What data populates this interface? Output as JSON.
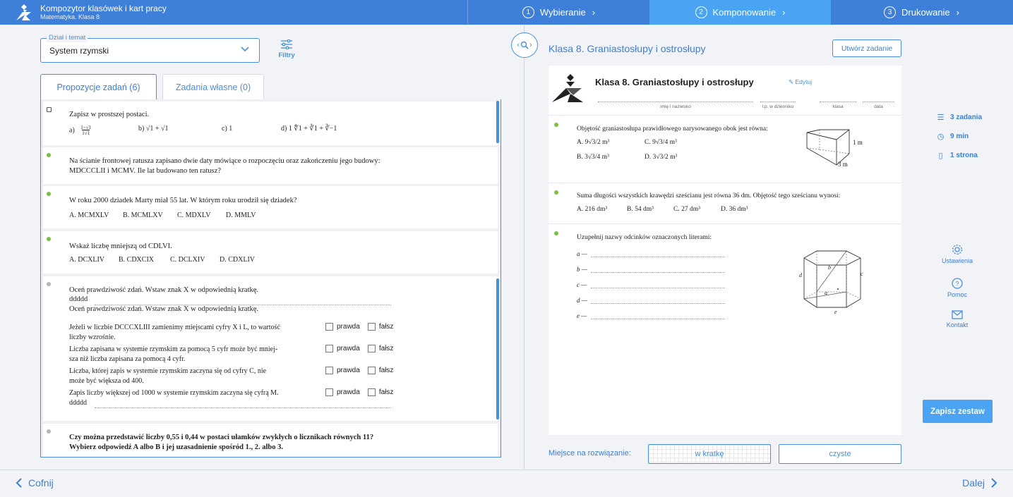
{
  "header": {
    "app_title": "Kompozytor klasówek i kart pracy",
    "app_subtitle": "Matematyka. Klasa 8",
    "steps": [
      {
        "num": "1",
        "label": "Wybieranie"
      },
      {
        "num": "2",
        "label": "Komponowanie"
      },
      {
        "num": "3",
        "label": "Drukowanie"
      }
    ]
  },
  "left": {
    "topic_label": "Dział i temat",
    "topic_value": "System rzymski",
    "filters_label": "Filtry",
    "tabs": [
      "Propozycje zadań (6)",
      "Zadania własne (0)"
    ],
    "tasks": [
      {
        "text": "Zapisz w prostszej postaci.",
        "options": [
          "a)",
          "b) √1 + √1",
          "c) 1",
          "d) 1 ∜1 + ∛1 + ∛−1"
        ]
      },
      {
        "text1": "Na ścianie frontowej ratusza zapisano dwie daty mówiące o rozpoczęciu oraz zakończeniu jego budowy:",
        "text2": "MDCCCLII i MCMV. Ile lat budowano ten ratusz?"
      },
      {
        "text": "W roku 2000 dziadek Marty miał 55 lat. W którym roku urodził się dziadek?",
        "options": [
          "A. MCMXLV",
          "B. MCMLXV",
          "C. MDXLV",
          "D. MMLV"
        ]
      },
      {
        "text": "Wskaż liczbę mniejszą od CDLVI.",
        "options": [
          "A. DCXLIV",
          "B. CDXCIX",
          "C. DCLXIV",
          "D. CDXLIV"
        ]
      },
      {
        "line1": "Oceń prawdziwość zdań. Wstaw znak X w odpowiednią kratkę.",
        "line2": "ddddd",
        "line3": "Oceń prawdziwość zdań. Wstaw znak X w odpowiednią kratkę.",
        "statements": [
          {
            "a": "Jeżeli w liczbie DCCCXLIII zamienimy miejscami cyfry X i L, to wartość",
            "b": "liczby wzrośnie."
          },
          {
            "a": "Liczba zapisana w systemie rzymskim za pomocą 5 cyfr może być mniej-",
            "b": "sza niż liczba zapisana za pomocą 4 cyfr."
          },
          {
            "a": "Liczba, której zapis w systemie rzymskim zaczyna się od cyfry C, nie",
            "b": "może być większa od 400."
          },
          {
            "a": "Zapis liczby większej od 1000 w systemie rzymskim zaczyna się cyfrą M.",
            "b": "ddddd"
          }
        ],
        "true_label": "prawda",
        "false_label": "fałsz"
      },
      {
        "line1": "Czy można przedstawić liczby 0,55 i 0,44 w postaci ułamków zwykłych o licznikach równych 11?",
        "line2": "Wybierz odpowiedź A albo B i jej uzasadnienie spośród 1., 2. albo 3."
      }
    ]
  },
  "right": {
    "title": "Klasa 8. Graniastosłupy i ostrosłupy",
    "create_button": "Utwórz zadanie",
    "paper": {
      "title": "Klasa 8. Graniastosłupy i ostrosłupy",
      "edit": "Edytuj",
      "fields": [
        "imię i nazwisko",
        "l.p. w dzienniku",
        "klasa",
        "data"
      ],
      "task1": {
        "text": "Objętość graniastosłupa prawidłowego narysowanego obok jest równa:",
        "options": [
          "A. 9√3/2 m³",
          "C. 9√3/4 m³",
          "B. 3√3/4 m³",
          "D. 3√3/2 m³"
        ],
        "dim1": "1 m",
        "dim2": "3 m"
      },
      "task2": {
        "text": "Suma długości wszystkich krawędzi sześcianu jest równa 36 dm. Objętość tego sześcianu wynosi:",
        "options": [
          "A. 216 dm³",
          "B. 54 dm³",
          "C. 27 dm³",
          "D. 36 dm³"
        ]
      },
      "task3": {
        "text": "Uzupełnij nazwy odcinków oznaczonych literami:",
        "letters": [
          "a —",
          "b —",
          "c —",
          "d —",
          "e —"
        ],
        "fig_labels": [
          "b",
          "c",
          "d",
          "a",
          "e"
        ]
      }
    },
    "stats": [
      "3 zadania",
      "9 min",
      "1 strona"
    ],
    "side_links": [
      "Ustawienia",
      "Pomoc",
      "Kontakt"
    ],
    "save_button": "Zapisz zestaw",
    "space_label": "Miejsce na rozwiązanie:",
    "space_options": [
      "w kratkę",
      "czyste"
    ]
  },
  "footer": {
    "back": "Cofnij",
    "next": "Dalej"
  },
  "colors": {
    "primary": "#3d7fd9",
    "active_step": "#4aa3f3",
    "green_dot": "#7bc043"
  }
}
